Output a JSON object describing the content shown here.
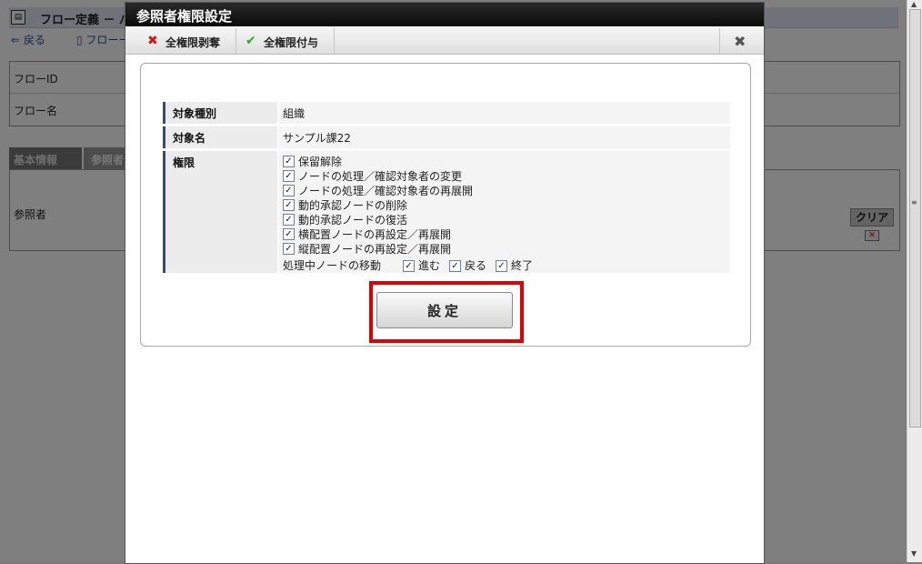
{
  "background": {
    "window_title": "フロー定義 － パ",
    "toolbar": {
      "back": "戻る",
      "flow": "フローー"
    },
    "rows": [
      {
        "label": "フローID"
      },
      {
        "label": "フロー名"
      }
    ],
    "tabs": [
      "基本情報",
      "参照者"
    ],
    "panel_label": "参照者",
    "clear_header": "クリア"
  },
  "dialog": {
    "title": "参照者権限設定",
    "toolbar": {
      "revoke_all": "全権限剥奪",
      "grant_all": "全権限付与",
      "close_icon": "✖"
    },
    "form": {
      "target_type_label": "対象種別",
      "target_type_value": "組織",
      "target_name_label": "対象名",
      "target_name_value": "サンプル課22",
      "permission_label": "権限",
      "permissions": [
        {
          "label": "保留解除",
          "checked": true
        },
        {
          "label": "ノードの処理／確認対象者の変更",
          "checked": true
        },
        {
          "label": "ノードの処理／確認対象者の再展開",
          "checked": true
        },
        {
          "label": "動的承認ノードの削除",
          "checked": true
        },
        {
          "label": "動的承認ノードの復活",
          "checked": true
        },
        {
          "label": "横配置ノードの再設定／再展開",
          "checked": true
        },
        {
          "label": "縦配置ノードの再設定／再展開",
          "checked": true
        }
      ],
      "move_label": "処理中ノードの移動",
      "move_options": [
        {
          "label": "進む",
          "checked": true
        },
        {
          "label": "戻る",
          "checked": true
        },
        {
          "label": "終了",
          "checked": true
        }
      ]
    },
    "submit_label": "設定"
  },
  "colors": {
    "highlight": "#e00000",
    "accent": "#334a86"
  }
}
